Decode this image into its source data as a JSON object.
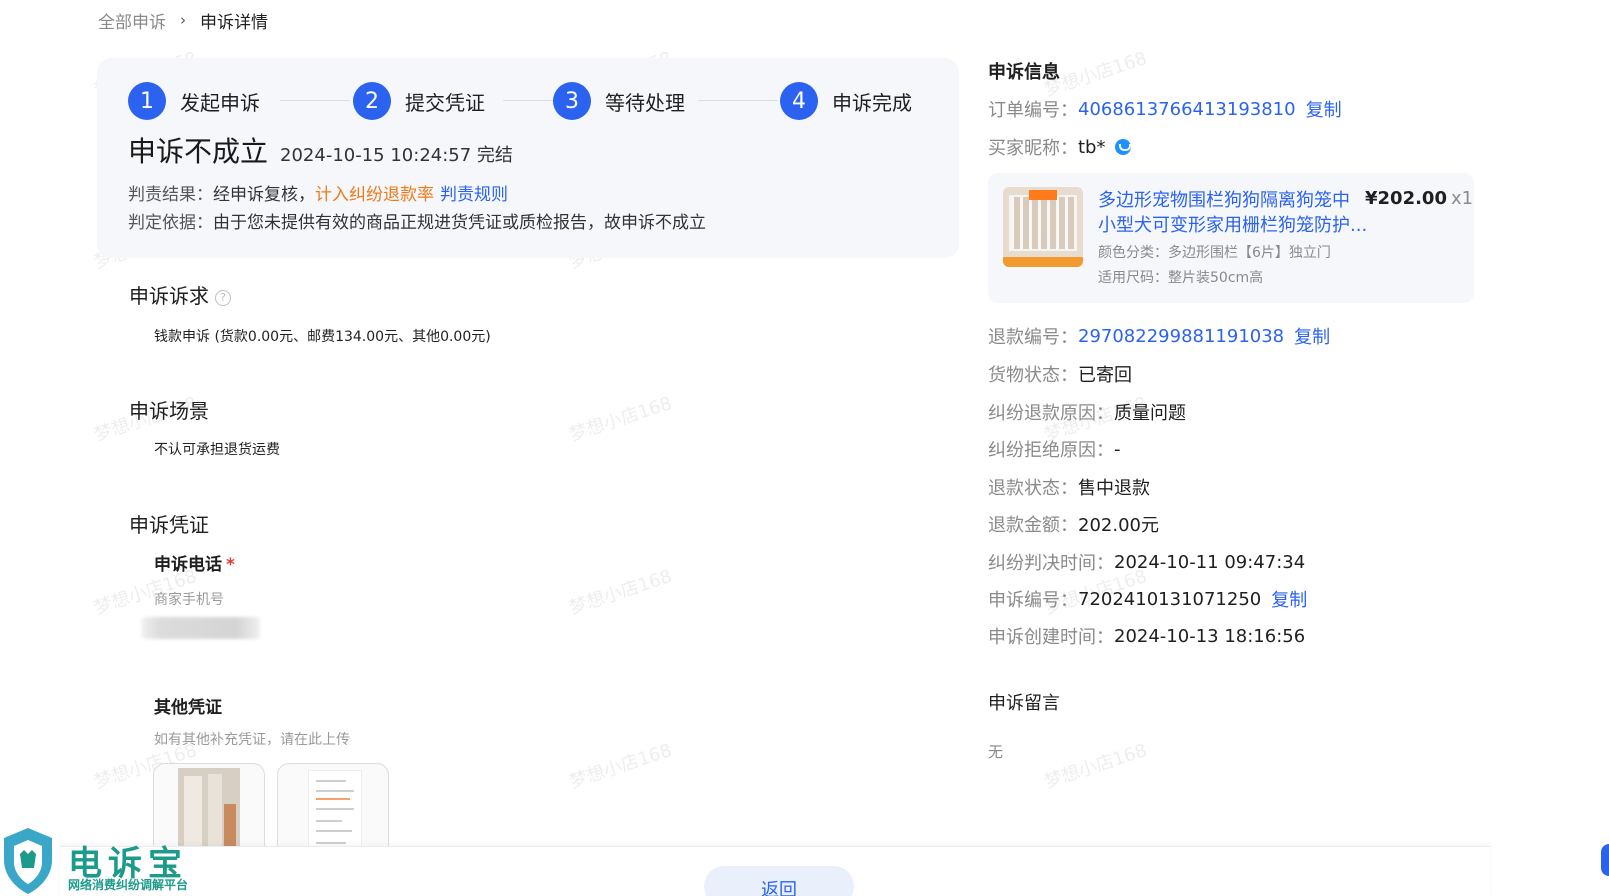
{
  "breadcrumb": {
    "root": "全部申诉",
    "sep": "›",
    "current": "申诉详情"
  },
  "steps": [
    {
      "num": "1",
      "label": "发起申诉"
    },
    {
      "num": "2",
      "label": "提交凭证"
    },
    {
      "num": "3",
      "label": "等待处理"
    },
    {
      "num": "4",
      "label": "申诉完成"
    }
  ],
  "result": {
    "title": "申诉不成立",
    "time": "2024-10-15 10:24:57 完结",
    "judge_label": "判责结果：",
    "judge_text": "经申诉复核，",
    "judge_orange": "计入纠纷退款率",
    "judge_link": "判责规则",
    "basis_label": "判定依据：",
    "basis_text": "由于您未提供有效的商品正规进货凭证或质检报告，故申诉不成立"
  },
  "appeal_request": {
    "title": "申诉诉求",
    "help": "?",
    "value": "钱款申诉 (货款0.00元、邮费134.00元、其他0.00元)"
  },
  "appeal_scene": {
    "title": "申诉场景",
    "value": "不认可承担退货运费"
  },
  "evidence": {
    "title": "申诉凭证",
    "phone_title": "申诉电话",
    "required": "*",
    "phone_hint": "商家手机号",
    "other_title": "其他凭证",
    "other_hint": "如有其他补充凭证，请在此上传"
  },
  "info": {
    "title": "申诉信息",
    "order_k": "订单编号：",
    "order_v": "4068613766413193810",
    "copy": "复制",
    "buyer_k": "买家昵称：",
    "buyer_v": "tb*",
    "refund_no_k": "退款编号：",
    "refund_no_v": "297082299881191038",
    "goods_status_k": "货物状态：",
    "goods_status_v": "已寄回",
    "reason_k": "纠纷退款原因：",
    "reason_v": "质量问题",
    "reject_k": "纠纷拒绝原因：",
    "reject_v": "-",
    "refund_status_k": "退款状态：",
    "refund_status_v": "售中退款",
    "refund_amount_k": "退款金额：",
    "refund_amount_v": "202.00元",
    "judge_time_k": "纠纷判决时间：",
    "judge_time_v": "2024-10-11 09:47:34",
    "appeal_no_k": "申诉编号：",
    "appeal_no_v": "7202410131071250",
    "create_time_k": "申诉创建时间：",
    "create_time_v": "2024-10-13 18:16:56"
  },
  "goods": {
    "name_line1": "多边形宠物围栏狗狗隔离狗笼中",
    "name_line2": "小型犬可变形家用栅栏狗笼防护...",
    "price": "¥202.00",
    "qty": "x1",
    "attr1": "颜色分类：多边形围栏【6片】独立门",
    "attr2": "适用尺码：整片装50cm高"
  },
  "message": {
    "title": "申诉留言",
    "value": "无"
  },
  "footer": {
    "back": "返回"
  },
  "logo": {
    "name": "电诉宝",
    "sub": "网络消费纠纷调解平台"
  },
  "watermark": "梦想小店168",
  "colors": {
    "accent": "#2b63f0",
    "warning": "#f07a1a",
    "brand": "#1d9b8a",
    "required": "#e53935"
  }
}
